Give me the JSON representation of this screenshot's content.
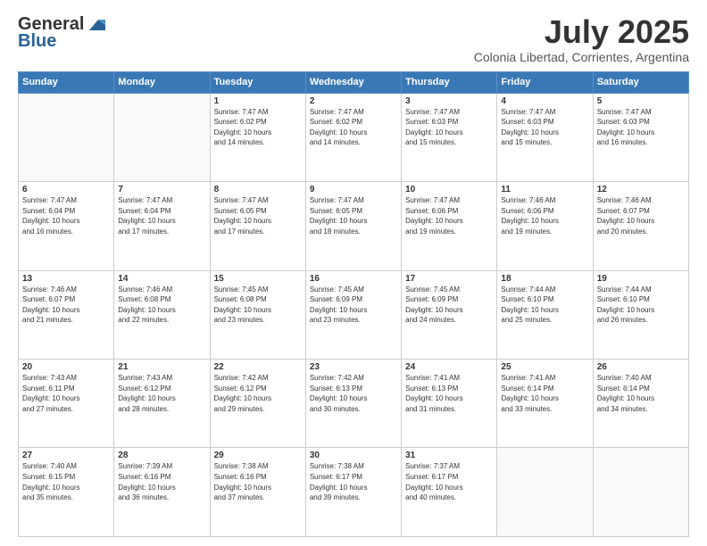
{
  "header": {
    "logo_general": "General",
    "logo_blue": "Blue",
    "month": "July 2025",
    "location": "Colonia Libertad, Corrientes, Argentina"
  },
  "days_of_week": [
    "Sunday",
    "Monday",
    "Tuesday",
    "Wednesday",
    "Thursday",
    "Friday",
    "Saturday"
  ],
  "weeks": [
    [
      {
        "day": "",
        "info": ""
      },
      {
        "day": "",
        "info": ""
      },
      {
        "day": "1",
        "info": "Sunrise: 7:47 AM\nSunset: 6:02 PM\nDaylight: 10 hours\nand 14 minutes."
      },
      {
        "day": "2",
        "info": "Sunrise: 7:47 AM\nSunset: 6:02 PM\nDaylight: 10 hours\nand 14 minutes."
      },
      {
        "day": "3",
        "info": "Sunrise: 7:47 AM\nSunset: 6:03 PM\nDaylight: 10 hours\nand 15 minutes."
      },
      {
        "day": "4",
        "info": "Sunrise: 7:47 AM\nSunset: 6:03 PM\nDaylight: 10 hours\nand 15 minutes."
      },
      {
        "day": "5",
        "info": "Sunrise: 7:47 AM\nSunset: 6:03 PM\nDaylight: 10 hours\nand 16 minutes."
      }
    ],
    [
      {
        "day": "6",
        "info": "Sunrise: 7:47 AM\nSunset: 6:04 PM\nDaylight: 10 hours\nand 16 minutes."
      },
      {
        "day": "7",
        "info": "Sunrise: 7:47 AM\nSunset: 6:04 PM\nDaylight: 10 hours\nand 17 minutes."
      },
      {
        "day": "8",
        "info": "Sunrise: 7:47 AM\nSunset: 6:05 PM\nDaylight: 10 hours\nand 17 minutes."
      },
      {
        "day": "9",
        "info": "Sunrise: 7:47 AM\nSunset: 6:05 PM\nDaylight: 10 hours\nand 18 minutes."
      },
      {
        "day": "10",
        "info": "Sunrise: 7:47 AM\nSunset: 6:06 PM\nDaylight: 10 hours\nand 19 minutes."
      },
      {
        "day": "11",
        "info": "Sunrise: 7:46 AM\nSunset: 6:06 PM\nDaylight: 10 hours\nand 19 minutes."
      },
      {
        "day": "12",
        "info": "Sunrise: 7:46 AM\nSunset: 6:07 PM\nDaylight: 10 hours\nand 20 minutes."
      }
    ],
    [
      {
        "day": "13",
        "info": "Sunrise: 7:46 AM\nSunset: 6:07 PM\nDaylight: 10 hours\nand 21 minutes."
      },
      {
        "day": "14",
        "info": "Sunrise: 7:46 AM\nSunset: 6:08 PM\nDaylight: 10 hours\nand 22 minutes."
      },
      {
        "day": "15",
        "info": "Sunrise: 7:45 AM\nSunset: 6:08 PM\nDaylight: 10 hours\nand 23 minutes."
      },
      {
        "day": "16",
        "info": "Sunrise: 7:45 AM\nSunset: 6:09 PM\nDaylight: 10 hours\nand 23 minutes."
      },
      {
        "day": "17",
        "info": "Sunrise: 7:45 AM\nSunset: 6:09 PM\nDaylight: 10 hours\nand 24 minutes."
      },
      {
        "day": "18",
        "info": "Sunrise: 7:44 AM\nSunset: 6:10 PM\nDaylight: 10 hours\nand 25 minutes."
      },
      {
        "day": "19",
        "info": "Sunrise: 7:44 AM\nSunset: 6:10 PM\nDaylight: 10 hours\nand 26 minutes."
      }
    ],
    [
      {
        "day": "20",
        "info": "Sunrise: 7:43 AM\nSunset: 6:11 PM\nDaylight: 10 hours\nand 27 minutes."
      },
      {
        "day": "21",
        "info": "Sunrise: 7:43 AM\nSunset: 6:12 PM\nDaylight: 10 hours\nand 28 minutes."
      },
      {
        "day": "22",
        "info": "Sunrise: 7:42 AM\nSunset: 6:12 PM\nDaylight: 10 hours\nand 29 minutes."
      },
      {
        "day": "23",
        "info": "Sunrise: 7:42 AM\nSunset: 6:13 PM\nDaylight: 10 hours\nand 30 minutes."
      },
      {
        "day": "24",
        "info": "Sunrise: 7:41 AM\nSunset: 6:13 PM\nDaylight: 10 hours\nand 31 minutes."
      },
      {
        "day": "25",
        "info": "Sunrise: 7:41 AM\nSunset: 6:14 PM\nDaylight: 10 hours\nand 33 minutes."
      },
      {
        "day": "26",
        "info": "Sunrise: 7:40 AM\nSunset: 6:14 PM\nDaylight: 10 hours\nand 34 minutes."
      }
    ],
    [
      {
        "day": "27",
        "info": "Sunrise: 7:40 AM\nSunset: 6:15 PM\nDaylight: 10 hours\nand 35 minutes."
      },
      {
        "day": "28",
        "info": "Sunrise: 7:39 AM\nSunset: 6:16 PM\nDaylight: 10 hours\nand 36 minutes."
      },
      {
        "day": "29",
        "info": "Sunrise: 7:38 AM\nSunset: 6:16 PM\nDaylight: 10 hours\nand 37 minutes."
      },
      {
        "day": "30",
        "info": "Sunrise: 7:38 AM\nSunset: 6:17 PM\nDaylight: 10 hours\nand 39 minutes."
      },
      {
        "day": "31",
        "info": "Sunrise: 7:37 AM\nSunset: 6:17 PM\nDaylight: 10 hours\nand 40 minutes."
      },
      {
        "day": "",
        "info": ""
      },
      {
        "day": "",
        "info": ""
      }
    ]
  ]
}
